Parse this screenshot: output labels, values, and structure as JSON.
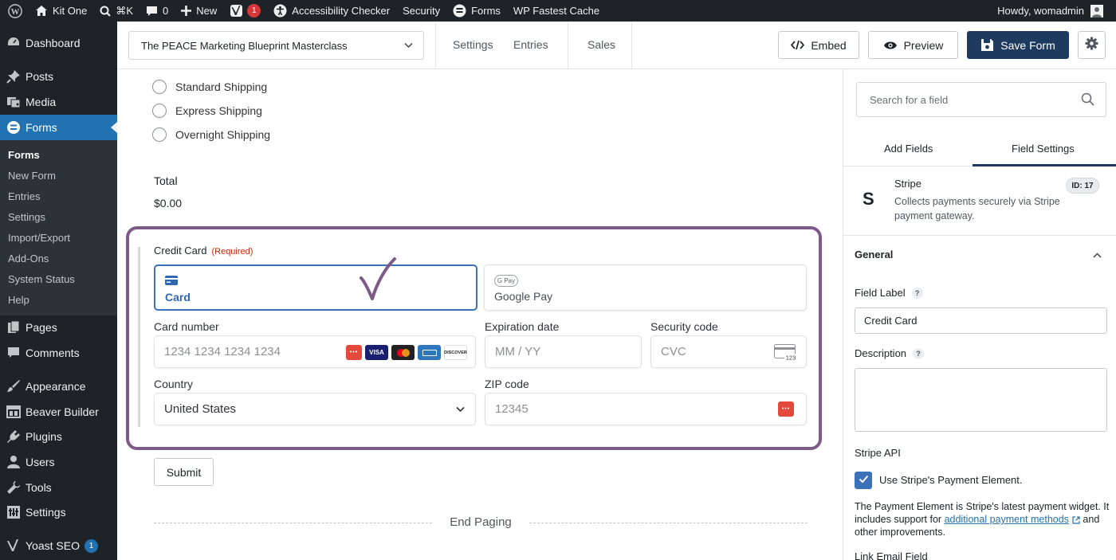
{
  "admin_bar": {
    "site_name": "Kit One",
    "shortcut": "⌘K",
    "comments_count": "0",
    "new_label": "New",
    "yoast_count": "1",
    "accessibility": "Accessibility Checker",
    "security": "Security",
    "forms": "Forms",
    "fastest_cache": "WP Fastest Cache",
    "greeting": "Howdy, womadmin"
  },
  "sidebar": {
    "dashboard": "Dashboard",
    "posts": "Posts",
    "media": "Media",
    "forms": "Forms",
    "submenu": [
      "Forms",
      "New Form",
      "Entries",
      "Settings",
      "Import/Export",
      "Add-Ons",
      "System Status",
      "Help"
    ],
    "pages": "Pages",
    "comments": "Comments",
    "appearance": "Appearance",
    "beaver_builder": "Beaver Builder",
    "plugins": "Plugins",
    "users": "Users",
    "tools": "Tools",
    "settings": "Settings",
    "yoast": "Yoast SEO",
    "yoast_count": "1"
  },
  "toolbar": {
    "form_name": "The PEACE Marketing Blueprint Masterclass",
    "settings": "Settings",
    "entries": "Entries",
    "sales": "Sales",
    "embed": "Embed",
    "preview": "Preview",
    "save": "Save Form"
  },
  "form": {
    "shipping_options": [
      "Standard Shipping",
      "Express Shipping",
      "Overnight Shipping"
    ],
    "total_label": "Total",
    "total_value": "$0.00",
    "cc_label": "Credit Card",
    "cc_required": "(Required)",
    "tab_card": "Card",
    "tab_gpay": "Google Pay",
    "gpay_badge": "G Pay",
    "card_number_label": "Card number",
    "card_number_placeholder": "1234 1234 1234 1234",
    "expiration_label": "Expiration date",
    "expiration_placeholder": "MM / YY",
    "security_label": "Security code",
    "security_placeholder": "CVC",
    "cvc_icon_text": "123",
    "country_label": "Country",
    "country_value": "United States",
    "zip_label": "ZIP code",
    "zip_placeholder": "12345",
    "brands": [
      "VISA",
      "DISCOVER"
    ],
    "submit": "Submit",
    "end_paging": "End Paging"
  },
  "panel": {
    "search_placeholder": "Search for a field",
    "tab_add": "Add Fields",
    "tab_settings": "Field Settings",
    "field_title": "Stripe",
    "field_desc": "Collects payments securely via Stripe payment gateway.",
    "field_id": "ID: 17",
    "section_general": "General",
    "field_label_label": "Field Label",
    "field_label_value": "Credit Card",
    "description_label": "Description",
    "stripe_api_label": "Stripe API",
    "use_payment_element": "Use Stripe's Payment Element.",
    "pe_desc_1": "The Payment Element is Stripe's latest payment widget. It includes support for",
    "pe_link": "additional payment methods",
    "pe_desc_2": "and other improvements.",
    "link_email_label": "Link Email Field"
  },
  "colors": {
    "admin_dark": "#1d2327",
    "wp_blue": "#2271b1",
    "save_button": "#1e3a5f",
    "highlight": "#7e5a86",
    "stripe_blue": "#3b72b9",
    "required": "#c02b0a"
  }
}
